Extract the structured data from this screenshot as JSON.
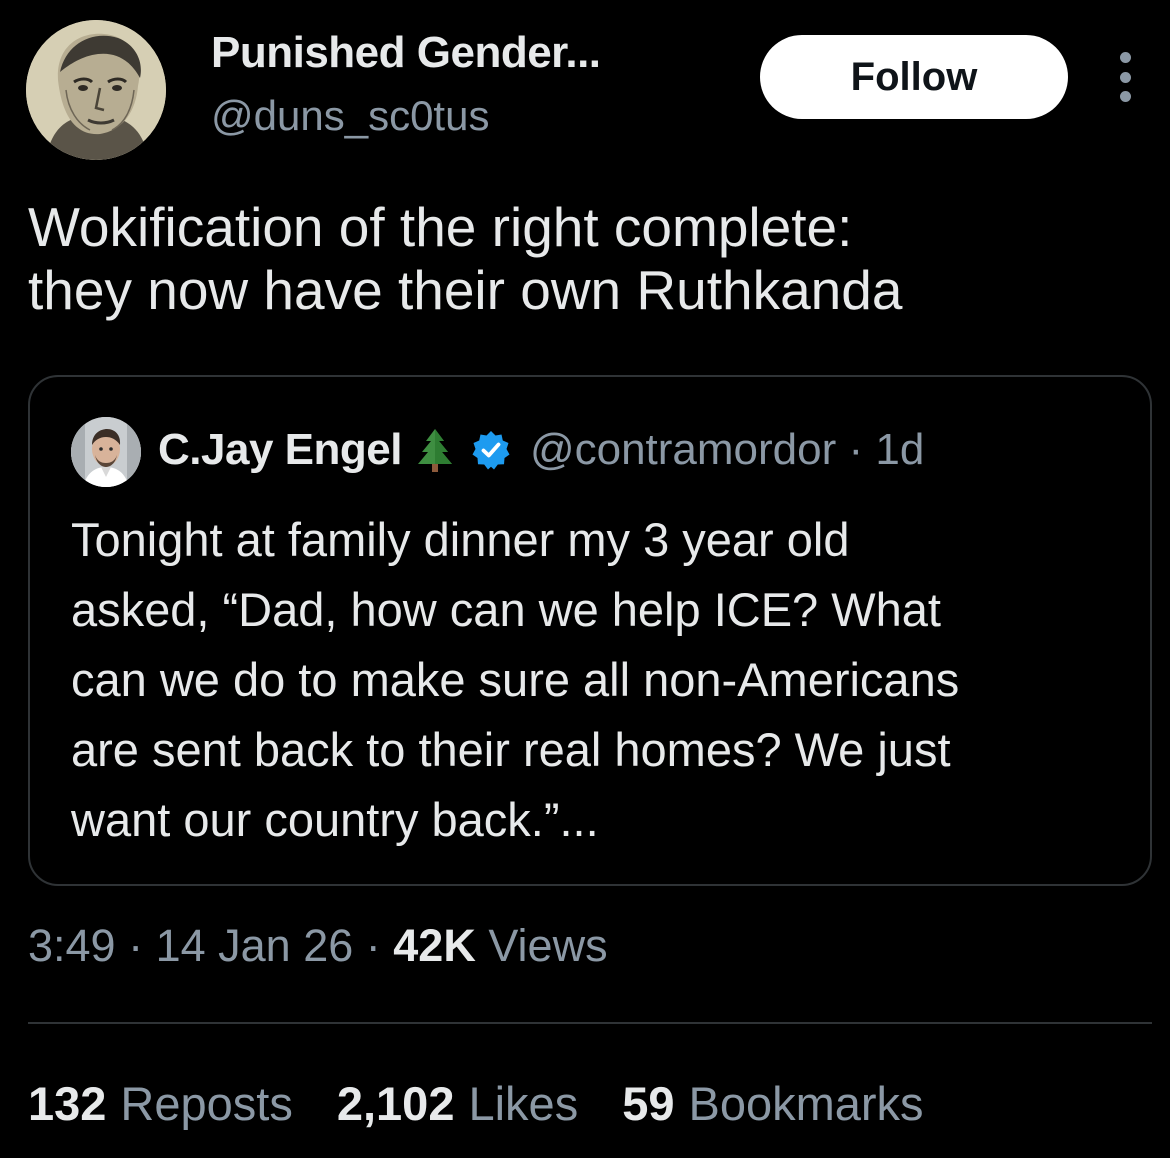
{
  "author": {
    "display_name": "Punished Gender...",
    "handle": "@duns_sc0tus",
    "avatar_icon": "portrait-engraving-avatar"
  },
  "follow_label": "Follow",
  "more_icon": "more-vertical-icon",
  "tweet": {
    "lines": [
      "Wokification of the right complete:",
      "they now have their own Ruthkanda"
    ]
  },
  "quote": {
    "display_name": "C.Jay Engel",
    "emoji_icon": "evergreen-tree-icon",
    "verified_icon": "verified-badge-icon",
    "verified_color": "#1d9bf0",
    "handle_and_time": "@contramordor · 1d",
    "lines": [
      "Tonight at family dinner my 3 year old",
      "asked, “Dad, how can we help ICE? What",
      "can we do to make sure all non-Americans",
      "are sent back to their real homes? We just",
      "want our country back.”..."
    ]
  },
  "meta": {
    "time": "3:49",
    "sep1": " · ",
    "date": "14 Jan 26",
    "sep2": " · ",
    "views_count": "42K",
    "views_label": "Views"
  },
  "stats": {
    "reposts_count": "132",
    "reposts_label": "Reposts",
    "likes_count": "2,102",
    "likes_label": "Likes",
    "bookmarks_count": "59",
    "bookmarks_label": "Bookmarks"
  },
  "colors": {
    "background": "#000000",
    "primary_text": "#e7e9ea",
    "secondary_text": "#8b98a5",
    "border": "#2f3336",
    "follow_bg": "#ffffff"
  }
}
